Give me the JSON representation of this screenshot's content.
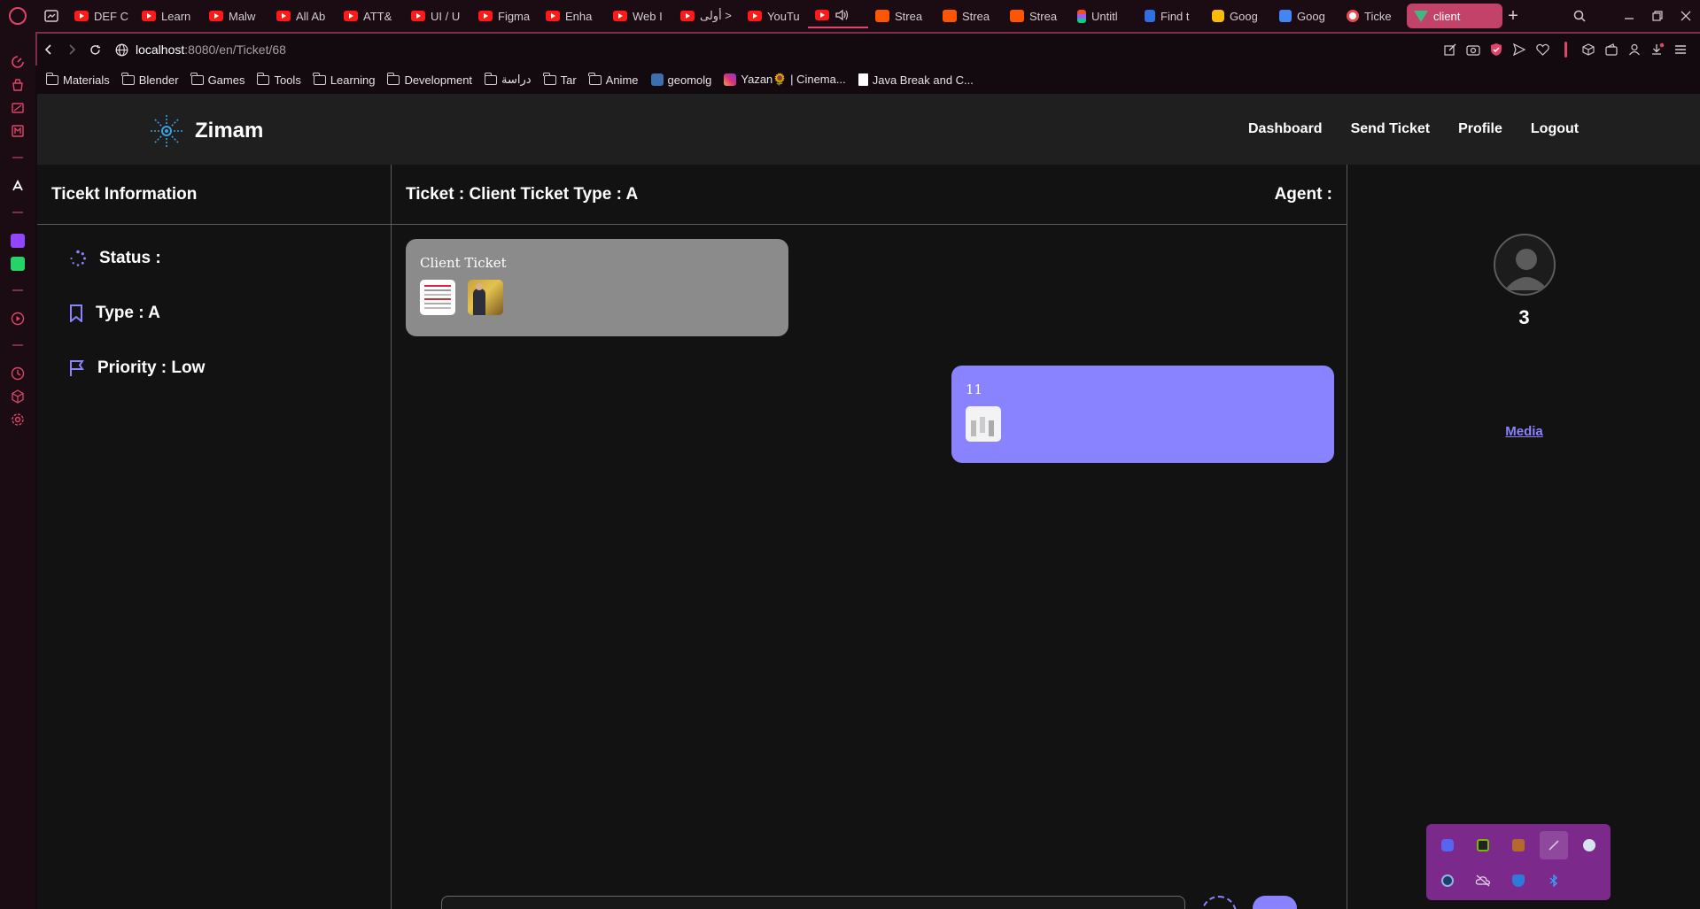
{
  "browser": {
    "tabs": [
      {
        "label": "DEF C",
        "icon": "youtube-icon"
      },
      {
        "label": "Learn",
        "icon": "youtube-icon"
      },
      {
        "label": "Malw",
        "icon": "youtube-icon"
      },
      {
        "label": "All Ab",
        "icon": "youtube-icon"
      },
      {
        "label": "ATT&",
        "icon": "youtube-icon"
      },
      {
        "label": "UI / U",
        "icon": "youtube-icon"
      },
      {
        "label": "Figma",
        "icon": "youtube-icon"
      },
      {
        "label": "Enha",
        "icon": "youtube-icon"
      },
      {
        "label": "Web I",
        "icon": "youtube-icon"
      },
      {
        "label": "أولى >",
        "icon": "youtube-icon"
      },
      {
        "label": "YouTu",
        "icon": "youtube-icon"
      },
      {
        "label": "",
        "icon": "youtube-icon",
        "audio": true
      },
      {
        "label": "Strea",
        "icon": "soundcloud-icon"
      },
      {
        "label": "Strea",
        "icon": "soundcloud-icon"
      },
      {
        "label": "Strea",
        "icon": "soundcloud-icon"
      },
      {
        "label": "Untitl",
        "icon": "figma-icon"
      },
      {
        "label": "Find t",
        "icon": "flag-icon"
      },
      {
        "label": "Goog",
        "icon": "keep-icon"
      },
      {
        "label": "Goog",
        "icon": "translate-icon"
      },
      {
        "label": "Ticke",
        "icon": "ticket-icon"
      },
      {
        "label": "client",
        "icon": "vue-icon",
        "active": true
      }
    ],
    "url_host": "localhost",
    "url_path": ":8080/en/Ticket/68",
    "bookmarks": [
      {
        "label": "Materials",
        "type": "folder"
      },
      {
        "label": "Blender",
        "type": "folder"
      },
      {
        "label": "Games",
        "type": "folder"
      },
      {
        "label": "Tools",
        "type": "folder"
      },
      {
        "label": "Learning",
        "type": "folder"
      },
      {
        "label": "Development",
        "type": "folder"
      },
      {
        "label": "دراسة",
        "type": "folder"
      },
      {
        "label": "Tar",
        "type": "folder"
      },
      {
        "label": "Anime",
        "type": "folder"
      },
      {
        "label": "geomolg",
        "type": "site"
      },
      {
        "label": "Yazan🌻 | Cinema...",
        "type": "instagram"
      },
      {
        "label": "Java Break and C...",
        "type": "page"
      }
    ]
  },
  "app": {
    "brand": "Zimam",
    "nav": [
      "Dashboard",
      "Send Ticket",
      "Profile",
      "Logout"
    ]
  },
  "info": {
    "title": "Ticekt Information",
    "status": "Status :",
    "type": "Type : A",
    "priority": "Priority : Low"
  },
  "chat": {
    "title": "Ticket : Client Ticket Type : A",
    "agent_label": "Agent :",
    "messages": [
      {
        "text": "Client Ticket",
        "from": "client"
      },
      {
        "text": "11",
        "from": "agent"
      }
    ]
  },
  "agent": {
    "count": "3",
    "media_link": "Media"
  },
  "colors": {
    "accent": "#8a83ff",
    "client_bubble": "#8b8b8b",
    "browser_accent": "#c2426a",
    "tray": "#7b2a8c"
  }
}
